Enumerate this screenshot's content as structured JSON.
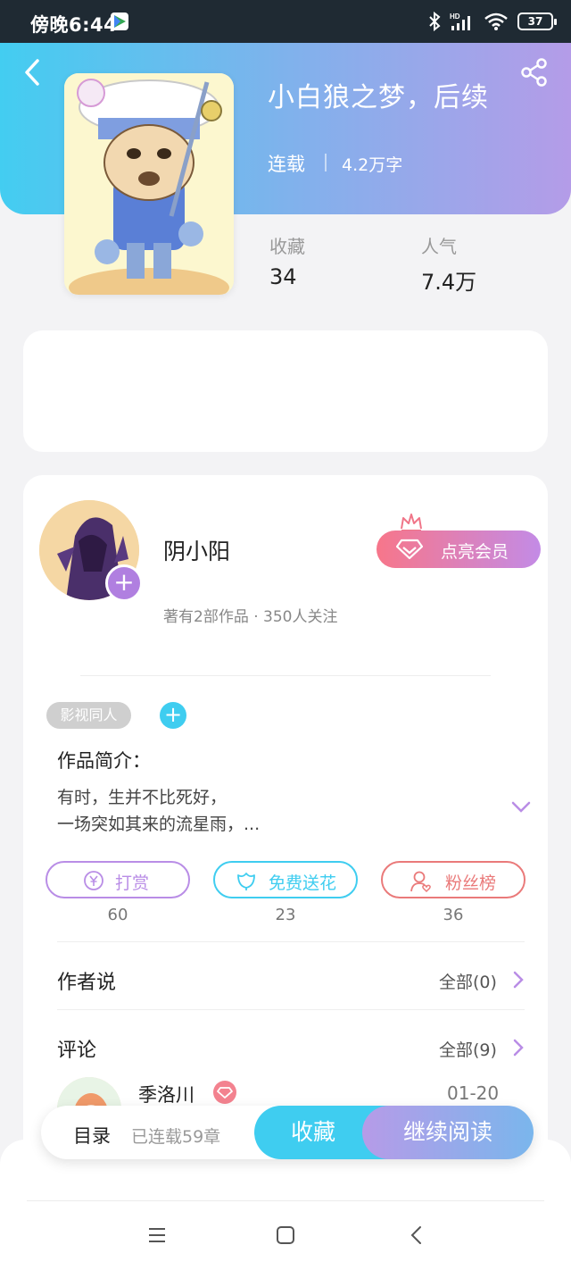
{
  "status_bar": {
    "time": "傍晚6:44",
    "battery": "37",
    "hd": "HD"
  },
  "book": {
    "title": "小白狼之梦，后续",
    "status": "连载",
    "word_count": "4.2万字",
    "stats": [
      {
        "label": "收藏",
        "value": "34"
      },
      {
        "label": "人气",
        "value": "7.4万"
      }
    ]
  },
  "author": {
    "name": "阴小阳",
    "info": "著有2部作品 · 350人关注",
    "vip_button": "点亮会员"
  },
  "tag": "影视同人",
  "intro": {
    "title": "作品简介：",
    "lines": [
      "有时，生并不比死好，",
      "一场突如其来的流星雨，..."
    ]
  },
  "actions": [
    {
      "label": "打赏",
      "count": "60",
      "color": "#b98de6"
    },
    {
      "label": "免费送花",
      "count": "23",
      "color": "#3fcdf0"
    },
    {
      "label": "粉丝榜",
      "count": "36",
      "color": "#ea7a7a"
    }
  ],
  "author_says": {
    "title": "作者说",
    "more": "全部(0)"
  },
  "comments": {
    "title": "评论",
    "more": "全部(9)",
    "first": {
      "name": "季洛川",
      "date": "01-20"
    }
  },
  "bottom": {
    "toc": "目录",
    "progress": "已连载59章",
    "favorite": "收藏",
    "continue": "继续阅读"
  },
  "colors": {
    "cyan": "#3fcdf0",
    "purple": "#b98de6",
    "pink": "#f3828f"
  }
}
